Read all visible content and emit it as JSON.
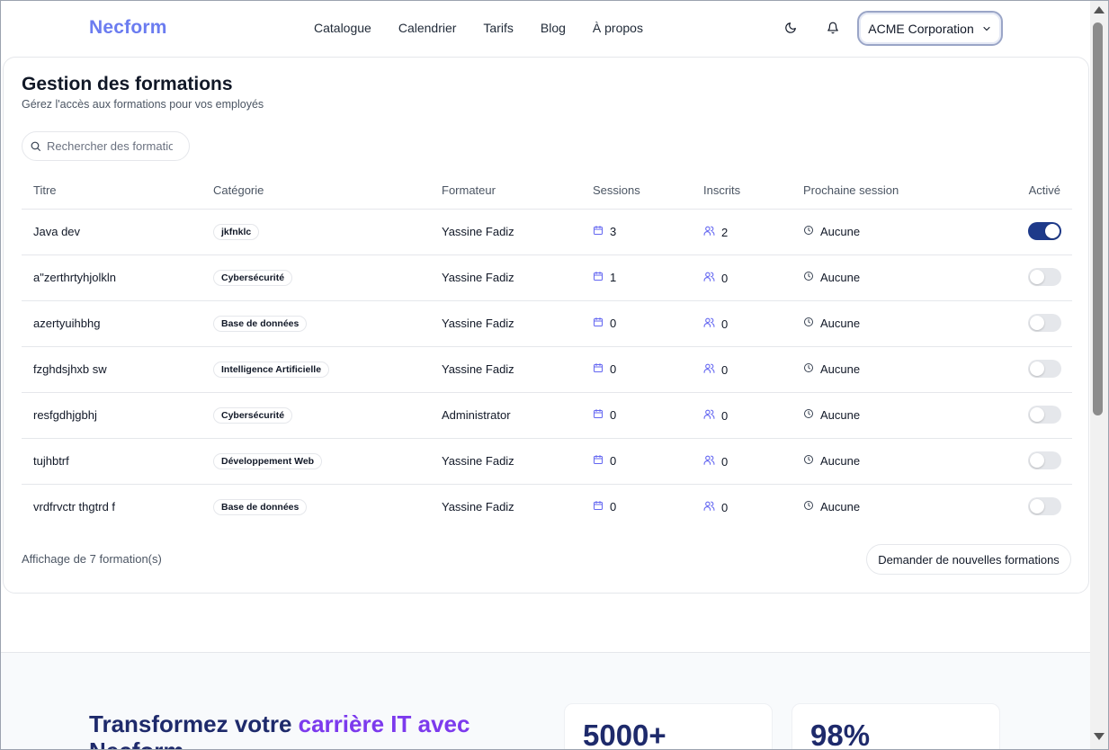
{
  "header": {
    "logo": "Necform",
    "nav": [
      "Catalogue",
      "Calendrier",
      "Tarifs",
      "Blog",
      "À propos"
    ],
    "org_name": "ACME Corporation"
  },
  "page": {
    "title": "Gestion des formations",
    "subtitle": "Gérez l'accès aux formations pour vos employés",
    "search_placeholder": "Rechercher des formations...",
    "columns": [
      "Titre",
      "Catégorie",
      "Formateur",
      "Sessions",
      "Inscrits",
      "Prochaine session",
      "Activé"
    ],
    "rows": [
      {
        "title": "Java dev",
        "category": "jkfnklc",
        "trainer": "Yassine Fadiz",
        "sessions": "3",
        "enrolled": "2",
        "next": "Aucune",
        "active": true
      },
      {
        "title": "a\"zerthrtyhjolkln",
        "category": "Cybersécurité",
        "trainer": "Yassine Fadiz",
        "sessions": "1",
        "enrolled": "0",
        "next": "Aucune",
        "active": false
      },
      {
        "title": "azertyuihbhg",
        "category": "Base de données",
        "trainer": "Yassine Fadiz",
        "sessions": "0",
        "enrolled": "0",
        "next": "Aucune",
        "active": false
      },
      {
        "title": "fzghdsjhxb sw",
        "category": "Intelligence Artificielle",
        "trainer": "Yassine Fadiz",
        "sessions": "0",
        "enrolled": "0",
        "next": "Aucune",
        "active": false
      },
      {
        "title": "resfgdhjgbhj",
        "category": "Cybersécurité",
        "trainer": "Administrator",
        "sessions": "0",
        "enrolled": "0",
        "next": "Aucune",
        "active": false
      },
      {
        "title": "tujhbtrf",
        "category": "Développement Web",
        "trainer": "Yassine Fadiz",
        "sessions": "0",
        "enrolled": "0",
        "next": "Aucune",
        "active": false
      },
      {
        "title": "vrdfrvctr thgtrd f",
        "category": "Base de données",
        "trainer": "Yassine Fadiz",
        "sessions": "0",
        "enrolled": "0",
        "next": "Aucune",
        "active": false
      }
    ],
    "footer_count": "Affichage de 7 formation(s)",
    "request_button": "Demander de nouvelles formations"
  },
  "bottom": {
    "hero_part1": "Transformez votre ",
    "hero_accent": "carrière IT avec",
    "hero_part2": "Necform",
    "stat1": "5000+",
    "stat2": "98%"
  },
  "colors": {
    "logo": "#6b7cf0",
    "toggle_on": "#1e3a8a",
    "accent": "#7c3aed",
    "heading_dark": "#1e2a6b"
  }
}
